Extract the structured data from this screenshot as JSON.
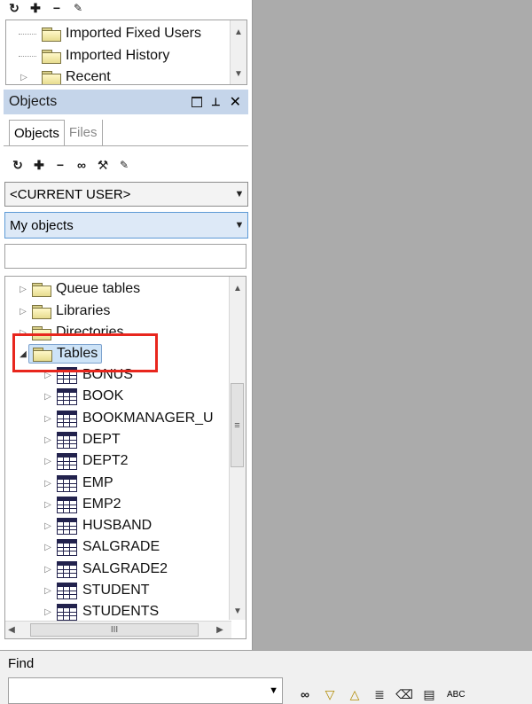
{
  "top_panel": {
    "toolbar": {
      "icons": [
        "refresh-icon",
        "add-icon",
        "remove-icon",
        "properties-icon"
      ]
    },
    "items": [
      {
        "label": "Imported Fixed Users"
      },
      {
        "label": "Imported History"
      },
      {
        "label": "Recent"
      }
    ]
  },
  "objects_panel": {
    "title": "Objects",
    "tabs": [
      {
        "label": "Objects",
        "active": true
      },
      {
        "label": "Files",
        "active": false
      }
    ],
    "user_select": {
      "value": "<CURRENT USER>"
    },
    "filter_select": {
      "value": "My objects"
    },
    "search": {
      "value": "",
      "placeholder": ""
    },
    "tree": {
      "folders": [
        "Queue tables",
        "Libraries",
        "Directories",
        "Tables"
      ],
      "tables": [
        "BONUS",
        "BOOK",
        "BOOKMANAGER_U",
        "DEPT",
        "DEPT2",
        "EMP",
        "EMP2",
        "HUSBAND",
        "SALGRADE",
        "SALGRADE2",
        "STUDENT",
        "STUDENTS"
      ]
    },
    "hscroll_thumb_glyph": "III",
    "vscroll_grip_glyph": "≡"
  },
  "find_panel": {
    "title": "Find",
    "combo_value": "",
    "spell_label": "ABC"
  },
  "colors": {
    "panel_header": "#c5d5ea",
    "highlight_box": "#e8261d",
    "selected_bg": "#cde3f7",
    "main_area": "#ababab"
  }
}
